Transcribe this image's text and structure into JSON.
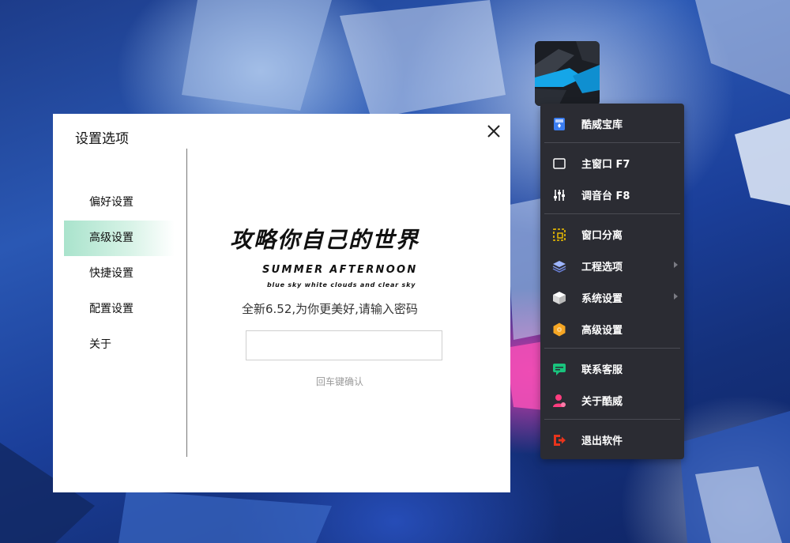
{
  "dialog": {
    "title": "设置选项",
    "nav": [
      {
        "label": "偏好设置",
        "active": false
      },
      {
        "label": "高级设置",
        "active": true
      },
      {
        "label": "快捷设置",
        "active": false
      },
      {
        "label": "配置设置",
        "active": false
      },
      {
        "label": "关于",
        "active": false
      }
    ],
    "slogan": "攻略你自己的世界",
    "subtitle": "SUMMER AFTERNOON",
    "tagline": "blue sky white clouds and clear sky",
    "prompt": "全新6.52,为你更美好,请输入密码",
    "password_value": "",
    "hint": "回车键确认"
  },
  "menu": {
    "items": [
      {
        "label": "酷威宝库",
        "icon": "treasure-book-icon",
        "color": "#3b7df0"
      },
      {
        "label": "主窗口  F7",
        "icon": "window-icon",
        "color": "#ffffff"
      },
      {
        "label": "调音台  F8",
        "icon": "mixer-sliders-icon",
        "color": "#ffffff"
      },
      {
        "label": "窗口分离",
        "icon": "detach-window-icon",
        "color": "#f2c200"
      },
      {
        "label": "工程选项",
        "icon": "layers-icon",
        "color": "#9fb6ff"
      },
      {
        "label": "系统设置",
        "icon": "cube-icon",
        "color": "#ffffff"
      },
      {
        "label": "高级设置",
        "icon": "hexagon-gear-icon",
        "color": "#f6a623"
      },
      {
        "label": "联系客服",
        "icon": "chat-support-icon",
        "color": "#19c37d"
      },
      {
        "label": "关于酷威",
        "icon": "user-profile-icon",
        "color": "#ff3d7f"
      },
      {
        "label": "退出软件",
        "icon": "exit-icon",
        "color": "#e8341c"
      }
    ]
  },
  "background": {
    "accent_pink": "#e23ca8",
    "base_blue": "#1d3c8a"
  }
}
